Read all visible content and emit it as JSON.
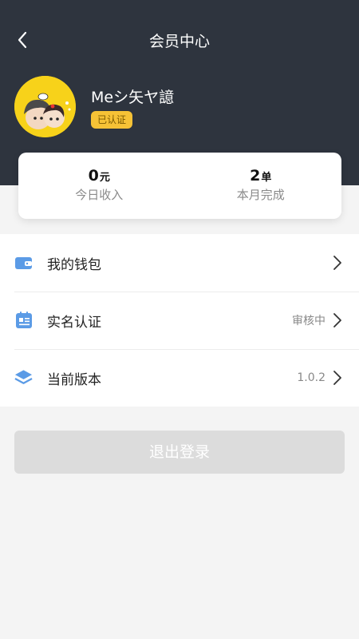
{
  "header": {
    "title": "会员中心"
  },
  "profile": {
    "username": "Meシ矢ヤ譩",
    "badge": "已认证"
  },
  "stats": [
    {
      "value": "0",
      "unit": "元",
      "label": "今日收入"
    },
    {
      "value": "2",
      "unit": "单",
      "label": "本月完成"
    }
  ],
  "menu": [
    {
      "label": "我的钱包",
      "value": "",
      "icon": "wallet-icon"
    },
    {
      "label": "实名认证",
      "value": "审核中",
      "icon": "id-card-icon"
    },
    {
      "label": "当前版本",
      "value": "1.0.2",
      "icon": "layers-icon"
    }
  ],
  "logout_label": "退出登录",
  "colors": {
    "header_bg": "#2e343e",
    "accent_blue": "#4a8fe0",
    "badge": "#f6c236",
    "logout_bg": "#dcdcdc"
  }
}
